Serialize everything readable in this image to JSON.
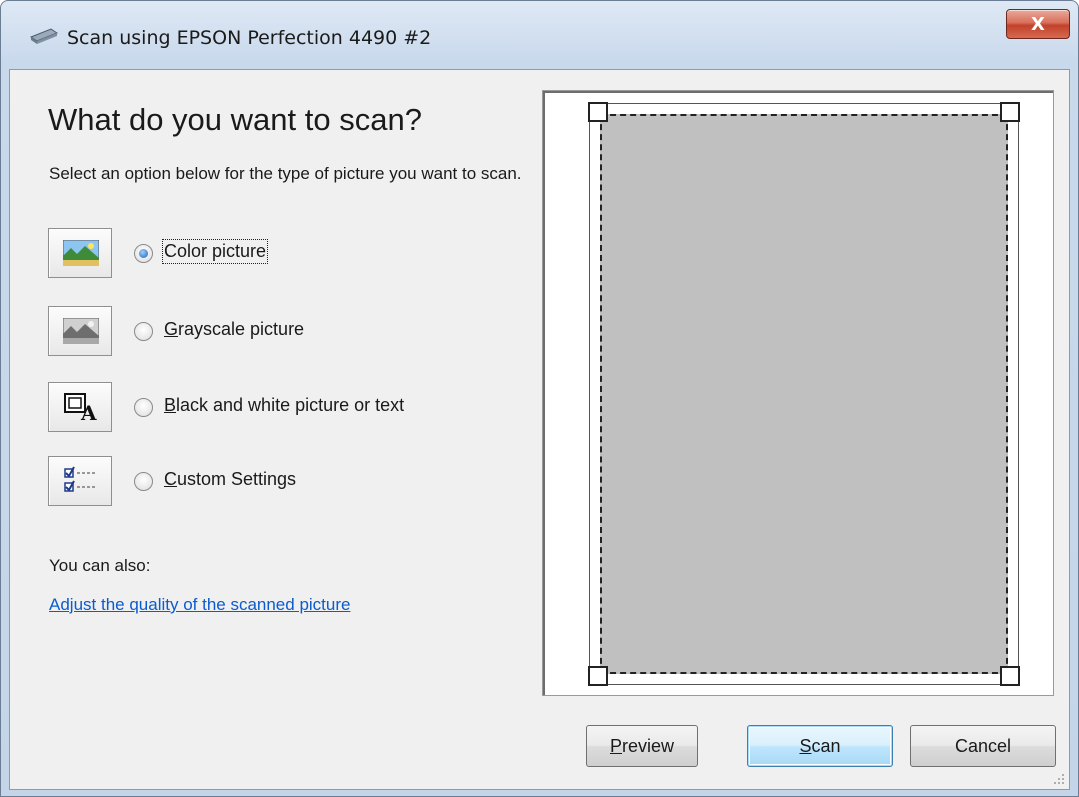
{
  "window": {
    "title": "Scan using EPSON Perfection 4490 #2",
    "close_glyph": "X"
  },
  "main": {
    "heading": "What do you want to scan?",
    "subtext": "Select an option below for the type of picture you want to scan."
  },
  "options": [
    {
      "label": "Color picture",
      "selected": true,
      "icon": "color-picture-icon"
    },
    {
      "label": "Grayscale picture",
      "selected": false,
      "icon": "grayscale-picture-icon"
    },
    {
      "label": "Black and white picture or text",
      "selected": false,
      "icon": "black-white-text-icon"
    },
    {
      "label": "Custom Settings",
      "selected": false,
      "icon": "custom-settings-icon"
    }
  ],
  "also": {
    "label": "You can also:",
    "link": "Adjust the quality of the scanned picture"
  },
  "buttons": {
    "preview": "Preview",
    "scan": "Scan",
    "cancel": "Cancel"
  },
  "colors": {
    "preview_fill": "#c0c0c0",
    "link": "#0b5ccd",
    "close_button": "#c2412a"
  }
}
